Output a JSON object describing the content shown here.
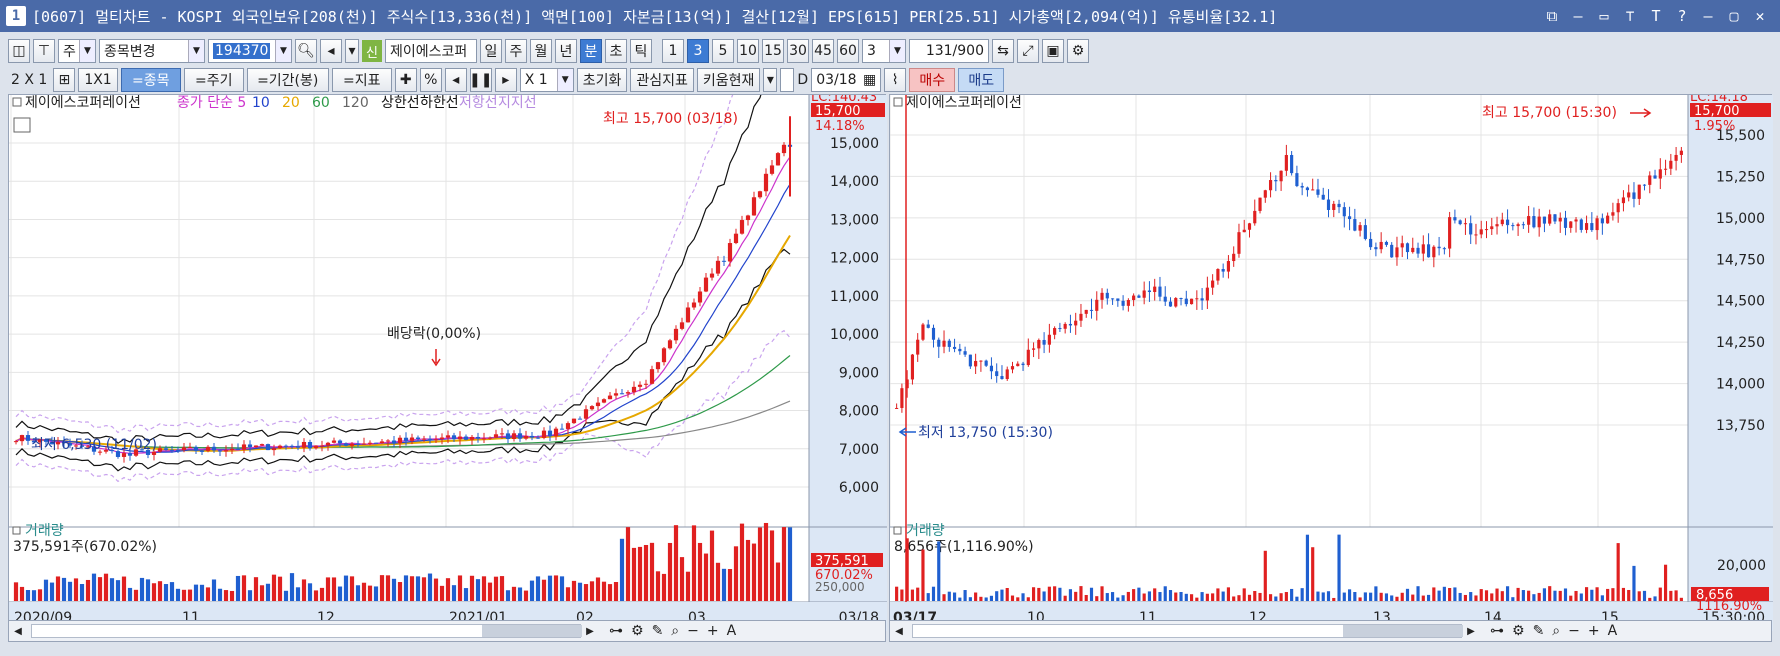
{
  "titlebar": {
    "window_number": "1",
    "title": "[0607] 멀티차트 - KOSPI 외국인보유[208(천)] 주식수[13,336(천)] 액면[100] 자본금[13(억)] 결산[12월] EPS[615] PER[25.51] 시가총액[2,094(억)] 유통비율[32.1]",
    "buttons": [
      "⧉",
      "—",
      "▭",
      "⊤",
      "T",
      "?",
      "—",
      "▢",
      "✕"
    ]
  },
  "toolbar1": {
    "unit_label": "주",
    "stock_change_label": "종목변경",
    "code_value": "194370",
    "new_badge": "신",
    "stock_name": "제이에스코퍼",
    "period_buttons": [
      "일",
      "주",
      "월",
      "년",
      "분",
      "초",
      "틱"
    ],
    "active_period": "분",
    "minute_buttons": [
      "1",
      "3",
      "5",
      "10",
      "15",
      "30",
      "45",
      "60"
    ],
    "active_minute": "3",
    "count_value": "3",
    "range_value": "131",
    "range_total": "/900"
  },
  "toolbar2": {
    "layout_label": "2 X 1",
    "layout_1x1": "1X1",
    "buttons": [
      "=종목",
      "=주기",
      "=기간(봉)",
      "=지표"
    ],
    "percent": "%",
    "zoom": "X 1",
    "reset": "초기화",
    "watch": "관심지표",
    "kiwoom": "키움현재",
    "date_value": "03/18",
    "buy": "매수",
    "sell": "매도"
  },
  "left_chart": {
    "stock_label": "제이에스코퍼레이션",
    "legend": [
      {
        "text": "종가 단순 5",
        "color": "#cc33cc"
      },
      {
        "text": "10",
        "color": "#2244cc"
      },
      {
        "text": "20",
        "color": "#e6a800"
      },
      {
        "text": "60",
        "color": "#2f9a4a"
      },
      {
        "text": "120",
        "color": "#666666"
      },
      {
        "text": "상한선",
        "color": "#111111"
      },
      {
        "text": "하한선",
        "color": "#111111"
      },
      {
        "text": "저항선",
        "color": "#b58ae0"
      },
      {
        "text": "지지선",
        "color": "#b58ae0"
      }
    ],
    "high_annotation": "최고 15,700 (03/18)",
    "low_annotation": "최저 6,530 (11/02)",
    "dividend_annotation": "배당락(0,00%)",
    "lc_label": "LC:140.43",
    "price_tag": "15,700",
    "pct_tag": "14.18%",
    "y_ticks": [
      "15,000",
      "14,000",
      "13,000",
      "12,000",
      "11,000",
      "10,000",
      "9,000",
      "8,000",
      "7,000",
      "6,000"
    ],
    "volume_label": "거래량",
    "volume_value": "375,591주(670.02%)",
    "volume_tag": "375,591",
    "volume_pct_tag": "670.02%",
    "volume_tick": "250,000",
    "x_ticks": [
      "2020/09",
      "11",
      "12",
      "2021/01",
      "02",
      "03"
    ],
    "x_right_label": "03/18"
  },
  "right_chart": {
    "stock_label": "제이에스코퍼레이션",
    "high_annotation": "최고 15,700 (15:30)",
    "low_annotation": "최저 13,750 (15:30)",
    "lc_label": "LC:14.18",
    "price_tag": "15,700",
    "pct_tag": "1.95%",
    "y_ticks": [
      "15,500",
      "15,250",
      "15,000",
      "14,750",
      "14,500",
      "14,250",
      "14,000",
      "13,750"
    ],
    "volume_label": "거래량",
    "volume_value": "8,656주(1,116.90%)",
    "volume_tick": "20,000",
    "volume_tag": "8,656",
    "volume_pct_tag": "1116.90%",
    "x_ticks": [
      "03/17",
      "10",
      "11",
      "12",
      "13",
      "14",
      "15"
    ],
    "x_right_label": "15:30:00"
  },
  "colors": {
    "up": "#e02020",
    "down": "#1f5fd0",
    "panel_bg": "#ffffff",
    "axis_bg": "#dbe6f4",
    "tag_red": "#e02020"
  }
}
